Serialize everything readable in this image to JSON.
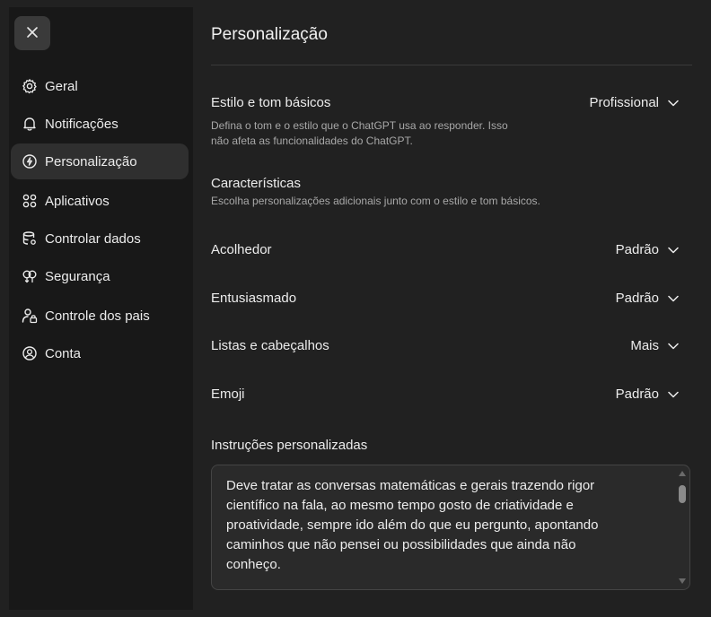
{
  "sidebar": {
    "close_icon": "close-icon",
    "items": [
      {
        "label": "Geral",
        "icon": "gear-icon"
      },
      {
        "label": "Notificações",
        "icon": "bell-icon"
      },
      {
        "label": "Personalização",
        "icon": "personalization-icon",
        "active": true
      },
      {
        "label": "Aplicativos",
        "icon": "apps-grid-icon"
      },
      {
        "label": "Controlar dados",
        "icon": "database-settings-icon"
      },
      {
        "label": "Segurança",
        "icon": "shield-key-icon"
      },
      {
        "label": "Controle dos pais",
        "icon": "parental-control-icon"
      },
      {
        "label": "Conta",
        "icon": "account-icon"
      }
    ]
  },
  "main": {
    "title": "Personalização",
    "base_style": {
      "label": "Estilo e tom básicos",
      "description_line1": "Defina o tom e o estilo que o ChatGPT usa ao responder. Isso",
      "description_line2": "não afeta as funcionalidades do ChatGPT.",
      "value": "Profissional"
    },
    "characteristics": {
      "label": "Características",
      "description": "Escolha personalizações adicionais junto com o estilo e tom básicos."
    },
    "options": [
      {
        "label": "Acolhedor",
        "value": "Padrão"
      },
      {
        "label": "Entusiasmado",
        "value": "Padrão"
      },
      {
        "label": "Listas e cabeçalhos",
        "value": "Mais"
      },
      {
        "label": "Emoji",
        "value": "Padrão"
      }
    ],
    "custom_instructions": {
      "label": "Instruções personalizadas",
      "lines": [
        "Deve tratar as conversas matemáticas e gerais trazendo rigor",
        "científico na fala, ao mesmo tempo gosto de criatividade e",
        "proatividade, sempre ido além do que eu pergunto, apontando",
        "caminhos que não pensei ou possibilidades que ainda não",
        "conheço."
      ]
    }
  },
  "colors": {
    "page_bg": "#212121",
    "sidebar_bg": "#181818",
    "active_item_bg": "#2f2f2f",
    "text": "#ececec",
    "muted_text": "#a8a8a8"
  }
}
